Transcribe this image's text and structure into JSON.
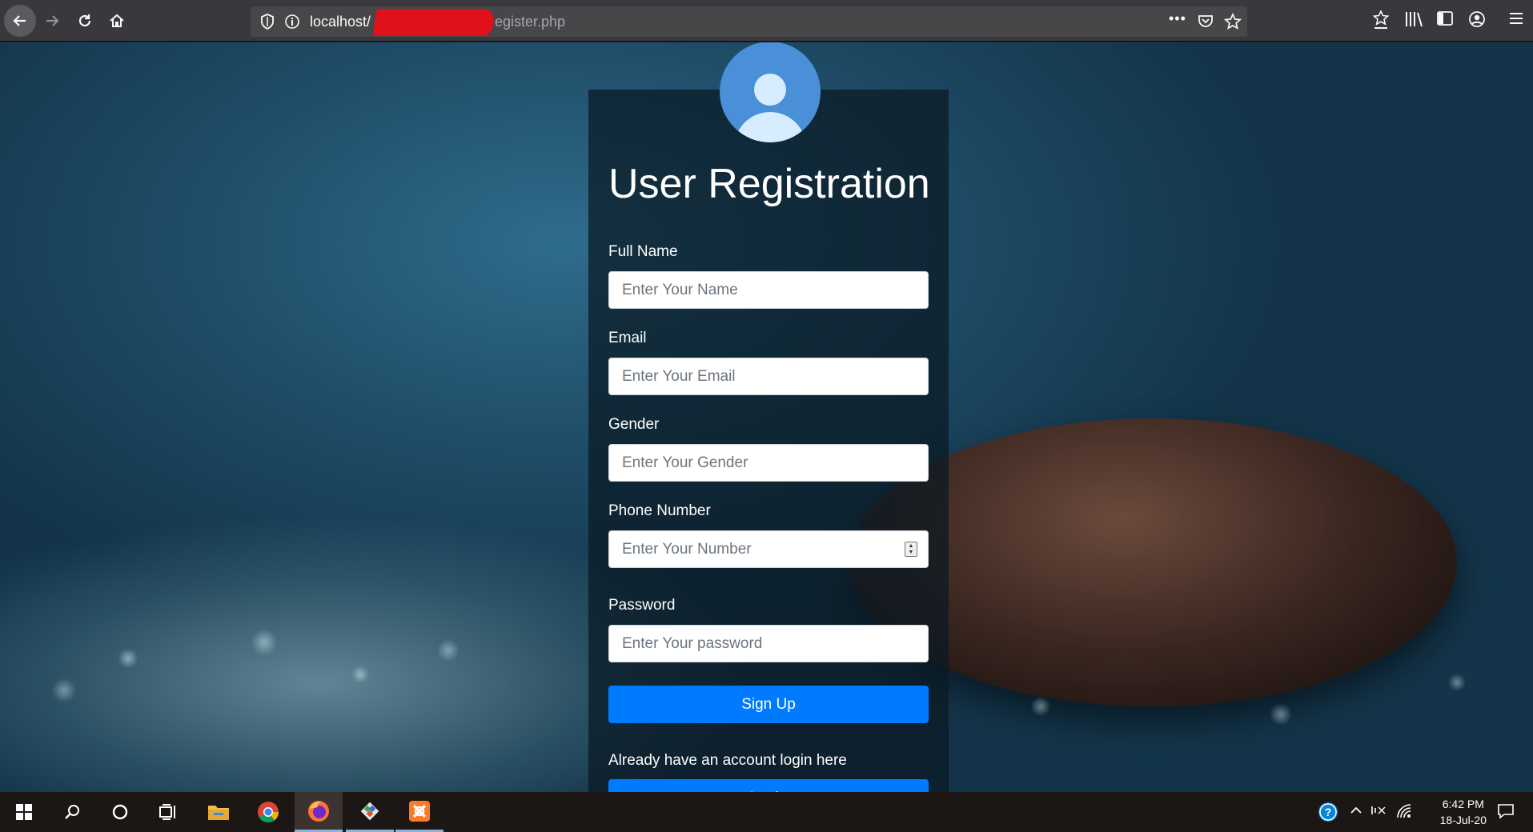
{
  "browser": {
    "url_host": "localhost/",
    "url_path": "egister.php"
  },
  "form": {
    "title": "User Registration",
    "fields": [
      {
        "label": "Full Name",
        "placeholder": "Enter Your Name"
      },
      {
        "label": "Email",
        "placeholder": "Enter Your Email"
      },
      {
        "label": "Gender",
        "placeholder": "Enter Your Gender"
      },
      {
        "label": "Phone Number",
        "placeholder": "Enter Your Number"
      },
      {
        "label": "Password",
        "placeholder": "Enter Your password"
      }
    ],
    "signup_label": "Sign Up",
    "login_hint": "Already have an account login here",
    "login_label": "Login"
  },
  "taskbar": {
    "time": "6:42 PM",
    "date": "18-Jul-20"
  },
  "colors": {
    "primary_button": "#007bff",
    "redaction": "#e0111a"
  }
}
